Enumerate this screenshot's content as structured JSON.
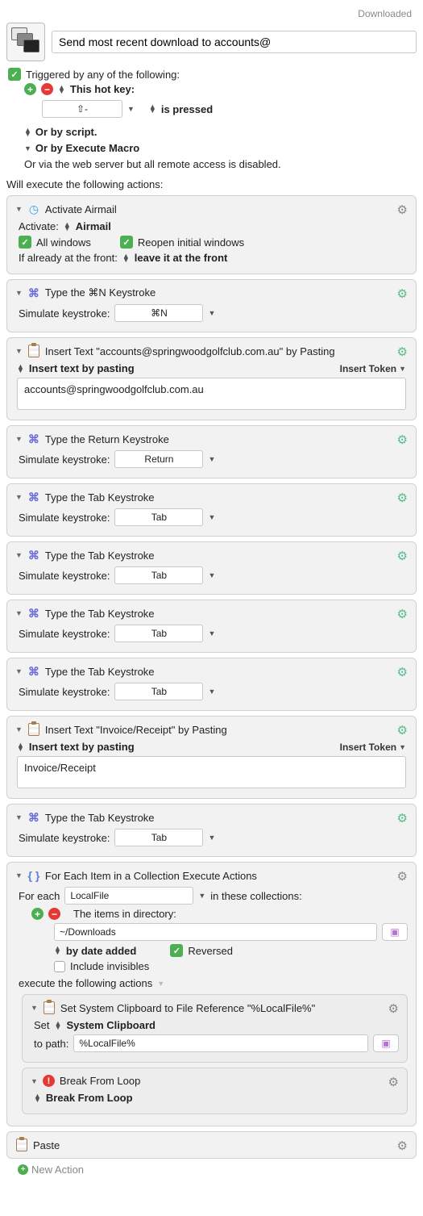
{
  "status": "Downloaded",
  "macro_title": "Send most recent download to accounts@",
  "trigger": {
    "heading": "Triggered by any of the following:",
    "hotkey_label": "This hot key:",
    "hotkey_value": "⇧-",
    "hotkey_suffix": "is pressed",
    "or_script": "Or by script.",
    "or_execute_macro": "Or by Execute Macro",
    "or_web": "Or via the web server but all remote access is disabled."
  },
  "exec_heading": "Will execute the following actions:",
  "activate": {
    "title": "Activate Airmail",
    "label": "Activate:",
    "app": "Airmail",
    "all_windows": "All windows",
    "reopen": "Reopen initial windows",
    "front_label": "If already at the front:",
    "front_value": "leave it at the front"
  },
  "keystroke_actions": {
    "n": {
      "title": "Type the ⌘N Keystroke",
      "value": "⌘N"
    },
    "return": {
      "title": "Type the Return Keystroke",
      "value": "Return"
    },
    "tab1": {
      "title": "Type the Tab Keystroke",
      "value": "Tab"
    },
    "tab2": {
      "title": "Type the Tab Keystroke",
      "value": "Tab"
    },
    "tab3": {
      "title": "Type the Tab Keystroke",
      "value": "Tab"
    },
    "tab4": {
      "title": "Type the Tab Keystroke",
      "value": "Tab"
    },
    "tab5": {
      "title": "Type the Tab Keystroke",
      "value": "Tab"
    },
    "sim_label": "Simulate keystroke:"
  },
  "insert1": {
    "title": "Insert Text \"accounts@springwoodgolfclub.com.au\" by Pasting",
    "mode": "Insert text by pasting",
    "token_label": "Insert Token",
    "value": "accounts@springwoodgolfclub.com.au"
  },
  "insert2": {
    "title": "Insert Text \"Invoice/Receipt\" by Pasting",
    "mode": "Insert text by pasting",
    "token_label": "Insert Token",
    "value": "Invoice/Receipt"
  },
  "foreach": {
    "title": "For Each Item in a Collection Execute Actions",
    "for_each": "For each",
    "var": "LocalFile",
    "in_collections": "in these collections:",
    "items_label": "The items in directory:",
    "path": "~/Downloads",
    "sort": "by date added",
    "reversed": "Reversed",
    "include_invisibles": "Include invisibles",
    "exec_label": "execute the following actions"
  },
  "setclip": {
    "title": "Set System Clipboard to File Reference \"%LocalFile%\"",
    "set": "Set",
    "clipboard": "System Clipboard",
    "to_path": "to path:",
    "value": "%LocalFile%"
  },
  "break": {
    "title": "Break From Loop",
    "mode": "Break From Loop"
  },
  "paste": {
    "title": "Paste"
  },
  "new_action": "New Action"
}
